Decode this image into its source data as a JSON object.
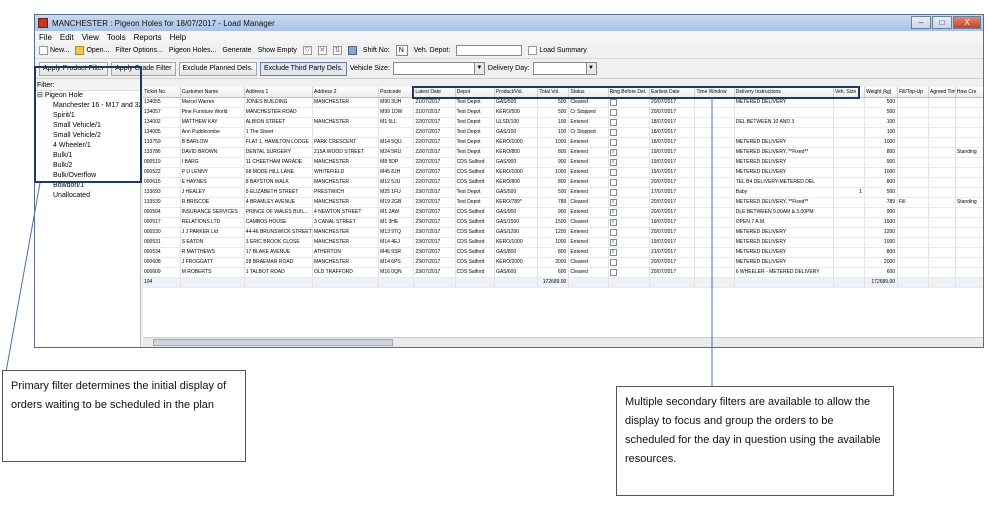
{
  "window": {
    "title": "MANCHESTER : Pigeon Holes for 18/07/2017 - Load Manager",
    "controls": [
      "–",
      "□",
      "X"
    ]
  },
  "menu": [
    "File",
    "Edit",
    "View",
    "Tools",
    "Reports",
    "Help"
  ],
  "toolbar": {
    "new_label": "New...",
    "open_label": "Open...",
    "filter_options_label": "Filter Options...",
    "pigeon_holes_label": "Pigeon Holes...",
    "generate_label": "Generate",
    "show_empty_label": "Show Empty",
    "shift_no_label": "Shift No:",
    "shift_no_value": "N",
    "veh_depot_label": "Veh. Depot:",
    "veh_depot_value": "",
    "load_summary_label": "Load Summary"
  },
  "filters_bar": {
    "apply_product_filter": "Apply Product Filter",
    "apply_grade_filter": "Apply Grade Filter",
    "exclude_planned": "Exclude Planned Dels.",
    "exclude_third_party": "Exclude Third Party Dels.",
    "vehicle_size_label": "Vehicle Size:",
    "vehicle_size_value": "",
    "delivery_day_label": "Delivery Day:",
    "delivery_day_value": ""
  },
  "filter_tree": {
    "label": "Filter:",
    "root": "Pigeon Hole",
    "items": [
      "Manchester 16 - M17 and 32/1",
      "Spirit/1",
      "Small Vehicle/1",
      "Small Vehicle/2",
      "4 Wheeler/1",
      "Bulk/1",
      "Bulk/2",
      "Bulk/Overflow",
      "Bowdon/1",
      "Unallocated"
    ]
  },
  "grid": {
    "columns": [
      "Ticket No.",
      "Customer Name",
      "Address 1",
      "Address 2",
      "Postcode",
      "Latest Date",
      "Depot",
      "Product/Vol.",
      "Total Vol.",
      "Status",
      "Ring Before Del.",
      "Earliest Date",
      "Time Window",
      "Delivery Instructions",
      "Veh. Size",
      "Weight (kg)",
      "Fill/Top-Up",
      "Agreed Tim",
      "How Cre"
    ],
    "rows": [
      [
        "134055",
        "Marcel Warren",
        "JONES BUILDING",
        "MANCHESTER",
        "M90 3UH",
        "21/07/2017",
        "Test Depot",
        "GAS/500",
        "500",
        "Cleared",
        "",
        "20/07/2017",
        "",
        "METERED DELIVERY",
        "",
        "500",
        "",
        "",
        ""
      ],
      [
        "134057",
        "Pine Furniture World",
        "MANCHESTER ROAD",
        "",
        "M99 1DW",
        "21/07/2017",
        "Test Depot",
        "KERO/500",
        "500",
        "Cr Stopped",
        "",
        "20/07/2017",
        "",
        "",
        "",
        "500",
        "",
        "",
        ""
      ],
      [
        "134002",
        "MATTHEW KAY",
        "ALBION STREET",
        "MANCHESTER",
        "M1 5LL",
        "22/07/2017",
        "Test Depot",
        "ULSD/100",
        "100",
        "Entered",
        "",
        "18/07/2017",
        "",
        "DEL BETWEEN 10 AND 3",
        "",
        "100",
        "",
        "",
        ""
      ],
      [
        "134005",
        "Ann Puddicombe",
        "1 The Street",
        "",
        "",
        "22/07/2017",
        "Test Depot",
        "GAS/100",
        "100",
        "Cr Stopped",
        "",
        "18/07/2017",
        "",
        "",
        "",
        "100",
        "",
        "",
        ""
      ],
      [
        "133759",
        "B BARLOW",
        "FLAT 1, HAMILTON LODGE",
        "PARK CRESCENT",
        "M14 5QU",
        "22/07/2017",
        "Test Depot",
        "KERO/1000",
        "1000",
        "Entered",
        "",
        "18/07/2017",
        "",
        "METERED DELIVERY",
        "",
        "1000",
        "",
        "",
        ""
      ],
      [
        "133786",
        "DAVID BROWN",
        "DENTAL SURGERY",
        "215A WOOD STREET",
        "M24 5RU",
        "22/07/2017",
        "Test Depot",
        "KERO/800",
        "800",
        "Entered",
        "x",
        "19/07/2017",
        "",
        "METERED DELIVERY, **Fixed**",
        "",
        "800",
        "",
        "",
        "Standing"
      ],
      [
        "000519",
        "I BARG",
        "11 CHEETHAM PARADE",
        "MANCHESTER",
        "M8 5DP",
        "22/07/2017",
        "CDS Salford",
        "GAS/900",
        "900",
        "Entered",
        "x",
        "19/07/2017",
        "",
        "METERED DELIVERY",
        "",
        "900",
        "",
        "",
        ""
      ],
      [
        "000522",
        "P U LENNY",
        "68 MODE HILL LANE",
        "WHITEFIELD",
        "M45 8JH",
        "22/07/2017",
        "CDS Salford",
        "KERO/1000",
        "1000",
        "Entered",
        "",
        "19/07/2017",
        "",
        "METERED DELIVERY",
        "",
        "1000",
        "",
        "",
        ""
      ],
      [
        "000615",
        "E HAYNES",
        "8 BAYSTON WALK",
        "MANCHESTER",
        "M12 5JU",
        "22/07/2017",
        "CDS Salford",
        "KERO/800",
        "800",
        "Entered",
        "",
        "20/07/2017",
        "",
        "TEL B4 DELIVERY-METERED DEL",
        "",
        "800",
        "",
        "",
        ""
      ],
      [
        "133693",
        "J HEALEY",
        "5 ELIZABETH STREET",
        "PRESTWICH",
        "M25 1FU",
        "23/07/2017",
        "Test Depot",
        "GAS/500",
        "500",
        "Entered",
        "",
        "17/07/2017",
        "",
        "Baby",
        "1",
        "500",
        "",
        "",
        ""
      ],
      [
        "133539",
        "R BRISCOE",
        "4 BRAMLEY AVENUE",
        "MANCHESTER",
        "M19 2GB",
        "23/07/2017",
        "Test Depot",
        "KERO/789*",
        "789",
        "Cleared",
        "x",
        "20/07/2017",
        "",
        "METERED DELIVERY, **Fixed**",
        "",
        "789",
        "Fill",
        "",
        "Standing"
      ],
      [
        "000504",
        "INSURANCE SERVICES",
        "PRINCE OF WALES BUIL...",
        "4 NEWTON STREET",
        "M1 2AW",
        "23/07/2017",
        "CDS Salford",
        "GAS/900",
        "900",
        "Entered",
        "x",
        "20/07/2017",
        "",
        "DLE BETWEEN 9.00AM & 3.00PM",
        "",
        "900",
        "",
        "",
        ""
      ],
      [
        "000517",
        "RELATIONS LTD",
        "CAMBOS HOUSE",
        "3 CANAL STREET",
        "M1 3HE",
        "23/07/2017",
        "CDS Salford",
        "GAS/1500",
        "1500",
        "Cleared",
        "x",
        "19/07/2017",
        "",
        "OPEN 7 A.M.",
        "",
        "1500",
        "",
        "",
        ""
      ],
      [
        "000530",
        "J J PARKER Ltd",
        "44-46 BRUNSWICK STREET",
        "MANCHESTER",
        "M13 9TQ",
        "23/07/2017",
        "CDS Salford",
        "GAS/1200",
        "1200",
        "Entered",
        "",
        "20/07/2017",
        "",
        "METERED DELIVERY",
        "",
        "1200",
        "",
        "",
        ""
      ],
      [
        "000531",
        "S EATON",
        "3 ERIC BROOK CLOSE",
        "MANCHESTER",
        "M14 4EJ",
        "23/07/2017",
        "CDS Salford",
        "KERO/1000",
        "1000",
        "Entered",
        "x",
        "19/07/2017",
        "",
        "METERED DELIVERY",
        "",
        "1000",
        "",
        "",
        ""
      ],
      [
        "000534",
        "R MATTHEWS",
        "17 BLAKE AVENUE",
        "ATHERTON",
        "M46 9SR",
        "23/07/2017",
        "CDS Salford",
        "GAS/800",
        "800",
        "Entered",
        "x",
        "21/07/2017",
        "",
        "METERED DELIVERY",
        "",
        "800",
        "",
        "",
        ""
      ],
      [
        "000608",
        "J FROGGATT",
        "28 BRAEMAR ROAD",
        "MANCHESTER",
        "M14 6PS",
        "23/07/2017",
        "CDS Salford",
        "KERO/2000",
        "2000",
        "Cleared",
        "",
        "20/07/2017",
        "",
        "METERED DELIVERY",
        "",
        "2000",
        "",
        "",
        ""
      ],
      [
        "000609",
        "M ROBERTS",
        "1 TALBOT ROAD",
        "OLD TRAFFORD",
        "M16 0QN",
        "23/07/2017",
        "CDS Salford",
        "GAS/600",
        "600",
        "Cleared",
        "",
        "20/07/2017",
        "",
        "6 WHEELER - METERED DELIVERY",
        "",
        "600",
        "",
        "",
        ""
      ]
    ],
    "summary": {
      "count": "104",
      "total_vol": "172689.00",
      "total_weight": "172689.00"
    }
  },
  "callouts": {
    "left": "Primary filter determines the initial display of orders waiting to be scheduled in the plan",
    "right": "Multiple secondary filters are available to allow the display to focus and group the orders to be scheduled for the day in question using the available resources."
  }
}
